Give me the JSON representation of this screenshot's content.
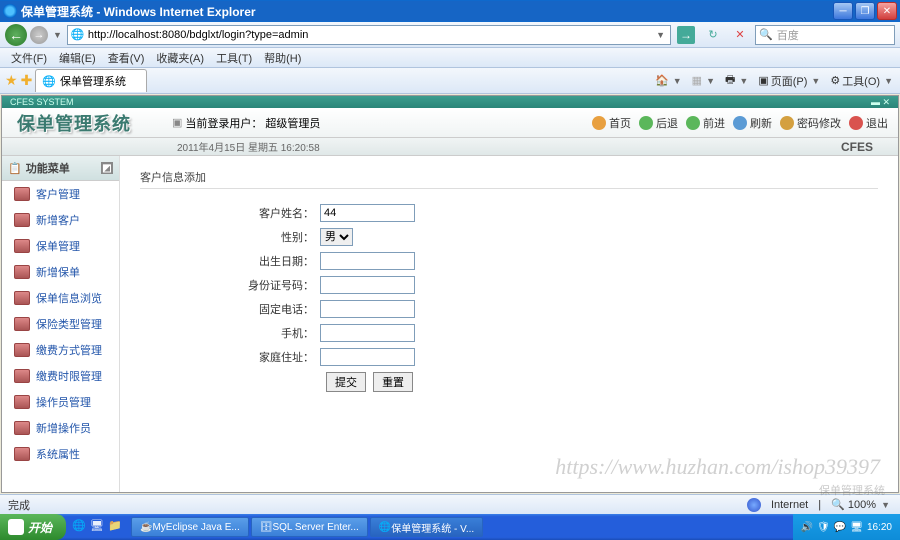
{
  "window": {
    "title": "保单管理系统 - Windows Internet Explorer"
  },
  "browser": {
    "url": "http://localhost:8080/bdglxt/login?type=admin",
    "search_placeholder": "百度",
    "menus": [
      "文件(F)",
      "编辑(E)",
      "查看(V)",
      "收藏夹(A)",
      "工具(T)",
      "帮助(H)"
    ],
    "tab_title": "保单管理系统",
    "tools": {
      "page": "页面(P)",
      "tools_label": "工具(O)"
    }
  },
  "app": {
    "logo": "保单管理系统",
    "current_user_label": "当前登录用户：",
    "current_user": "超级管理员",
    "datetime": "2011年4月15日 星期五 16:20:58",
    "brand": "CFES",
    "actions": {
      "home": "首页",
      "back": "后退",
      "forward": "前进",
      "refresh": "刷新",
      "pwd": "密码修改",
      "exit": "退出"
    }
  },
  "sidebar": {
    "title": "功能菜单",
    "items": [
      "客户管理",
      "新增客户",
      "保单管理",
      "新增保单",
      "保单信息浏览",
      "保险类型管理",
      "缴费方式管理",
      "缴费时限管理",
      "操作员管理",
      "新增操作员",
      "系统属性"
    ]
  },
  "form": {
    "title": "客户信息添加",
    "fields": {
      "name": {
        "label": "客户姓名：",
        "value": "44"
      },
      "gender": {
        "label": "性别：",
        "value": "男"
      },
      "birth": {
        "label": "出生日期：",
        "value": ""
      },
      "idcard": {
        "label": "身份证号码：",
        "value": ""
      },
      "phone": {
        "label": "固定电话：",
        "value": ""
      },
      "mobile": {
        "label": "手机：",
        "value": ""
      },
      "address": {
        "label": "家庭住址：",
        "value": ""
      }
    },
    "buttons": {
      "submit": "提交",
      "reset": "重置"
    }
  },
  "status": {
    "done": "完成",
    "zone": "Internet",
    "zoom": "100%"
  },
  "taskbar": {
    "start": "开始",
    "tasks": [
      "MyEclipse Java E...",
      "SQL Server Enter...",
      "保单管理系统 - V..."
    ],
    "time": "16:20"
  },
  "watermark": "https://www.huzhan.com/ishop39397",
  "watermark2": "保单管理系统"
}
